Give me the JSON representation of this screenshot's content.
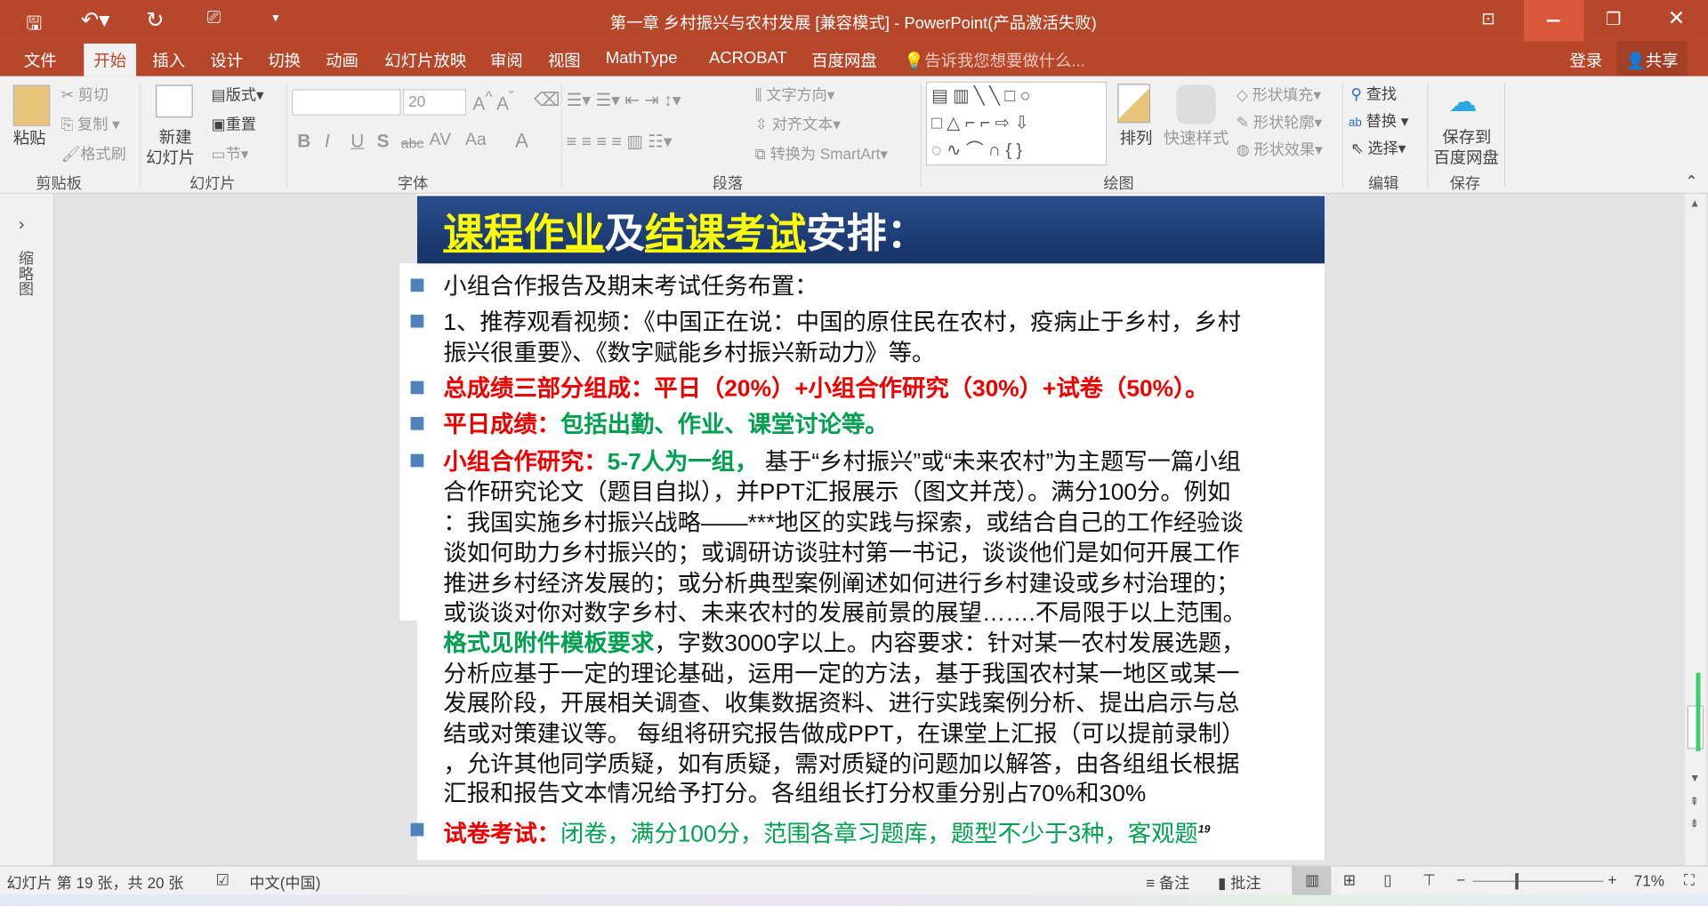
{
  "window": {
    "title": "第一章 乡村振兴与农村发展 [兼容模式] - PowerPoint(产品激活失败)"
  },
  "qat": {
    "save": "save-icon",
    "undo": "undo-icon",
    "redo": "redo-icon",
    "present": "present-icon"
  },
  "tabs": [
    "文件",
    "开始",
    "插入",
    "设计",
    "切换",
    "动画",
    "幻灯片放映",
    "审阅",
    "视图",
    "MathType",
    "ACROBAT",
    "百度网盘"
  ],
  "tell_me": "告诉我您想要做什么...",
  "login": "登录",
  "share": "共享",
  "ribbon": {
    "clipboard": {
      "paste": "粘贴",
      "cut": "剪切",
      "copy": "复制",
      "format_painter": "格式刷",
      "label": "剪贴板"
    },
    "slides": {
      "new_slide_1": "新建",
      "new_slide_2": "幻灯片",
      "layout": "版式",
      "reset": "重置",
      "section": "节",
      "label": "幻灯片"
    },
    "font": {
      "font_name": "",
      "font_size": "20",
      "label": "字体",
      "bold": "B",
      "italic": "I",
      "underline": "U",
      "shadow": "S",
      "strike": "abc",
      "spacing": "AV",
      "case": "Aa",
      "color": "A"
    },
    "paragraph": {
      "text_direction": "文字方向",
      "align_text": "对齐文本",
      "smartart": "转换为 SmartArt",
      "label": "段落"
    },
    "drawing": {
      "arrange": "排列",
      "quick_styles": "快速样式",
      "shape_fill": "形状填充",
      "shape_outline": "形状轮廓",
      "shape_effects": "形状效果",
      "label": "绘图"
    },
    "editing": {
      "find": "查找",
      "replace": "替换",
      "select": "选择",
      "label": "编辑"
    },
    "save": {
      "save_to_1": "保存到",
      "save_to_2": "百度网盘",
      "label": "保存"
    }
  },
  "left_pane": {
    "label": "缩略图"
  },
  "slide": {
    "title": {
      "p1": "课程作业",
      "p2": "及",
      "p3": "结课考试",
      "p4": "安排："
    },
    "b1": "小组合作报告及期末考试任务布置：",
    "b2": [
      "1、推荐观看视频：《中国正在说：中国的原住民在农村，疫病止于乡村，乡村",
      "振兴很重要》、《数字赋能乡村振兴新动力》等。"
    ],
    "b3": "总成绩三部分组成：平日（20%）+小组合作研究（30%）+试卷（50%）。",
    "b4": {
      "a": "平日成绩：",
      "b": "包括出勤、作业、课堂讨论等。"
    },
    "b5": {
      "a": "小组合作研究：",
      "b": "5-7",
      "c": "人为一组，",
      "d": "基于“乡村振兴”或“未来农村”为主题写一篇小组",
      "lines": [
        "合作研究论文（题目自拟），并PPT汇报展示（图文并茂）。满分100分。例如",
        "：我国实施乡村振兴战略——***地区的实践与探索，或结合自己的工作经验谈",
        "谈如何助力乡村振兴的；或调研访谈驻村第一书记，谈谈他们是如何开展工作",
        "推进乡村经济发展的；或分析典型案例阐述如何进行乡村建设或乡村治理的；",
        "或谈谈对你对数字乡村、未来农村的发展前景的展望…….不局限于以上范围。"
      ],
      "fmt": "格式见附件模板要求",
      "fmt_rest": "，字数3000字以上。内容要求：针对某一农村发展选题，",
      "lines2": [
        "分析应基于一定的理论基础，运用一定的方法，基于我国农村某一地区或某一",
        "发展阶段，开展相关调查、收集数据资料、进行实践案例分析、提出启示与总",
        "结或对策建议等。 每组将研究报告做成PPT，在课堂上汇报（可以提前录制）",
        "，允许其他同学质疑，如有质疑，需对质疑的问题加以解答，由各组组长根据",
        "汇报和报告文本情况给予打分。各组组长打分权重分别占70%和30%"
      ]
    },
    "b6": {
      "a": "试卷考试：",
      "b": "闭卷，满分100分，范围各章习题库，题型不少于3种，客观题"
    },
    "page_number": "19"
  },
  "status": {
    "slide_info": "幻灯片 第 19 张，共 20 张",
    "language": "中文(中国)",
    "notes": "备注",
    "comments": "批注",
    "zoom": "71%"
  },
  "colors": {
    "accent": "#b7472a",
    "title_band": "#1b3a72",
    "red": "#ee0000",
    "green": "#00a050",
    "bullet": "#4f81bd"
  }
}
